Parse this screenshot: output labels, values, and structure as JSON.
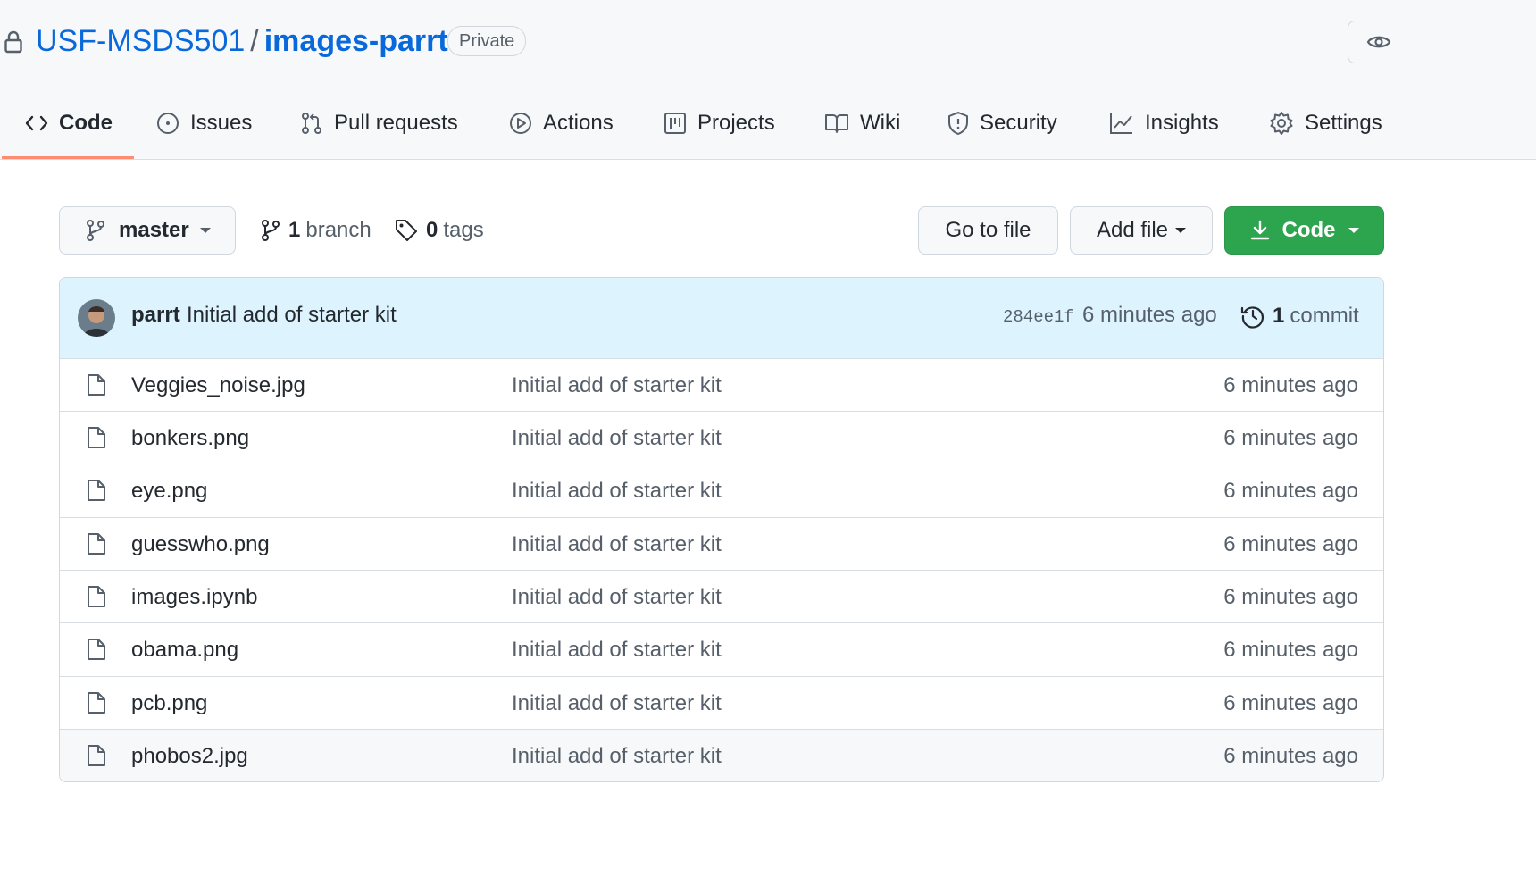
{
  "repo": {
    "owner": "USF-MSDS501",
    "separator": "/",
    "name": "images-parrt",
    "visibility": "Private"
  },
  "tabs": [
    {
      "label": "Code",
      "icon": "code-icon",
      "selected": true
    },
    {
      "label": "Issues",
      "icon": "issue-icon"
    },
    {
      "label": "Pull requests",
      "icon": "pull-request-icon"
    },
    {
      "label": "Actions",
      "icon": "play-icon"
    },
    {
      "label": "Projects",
      "icon": "project-icon"
    },
    {
      "label": "Wiki",
      "icon": "book-icon"
    },
    {
      "label": "Security",
      "icon": "shield-icon"
    },
    {
      "label": "Insights",
      "icon": "graph-icon"
    },
    {
      "label": "Settings",
      "icon": "gear-icon"
    }
  ],
  "branch": {
    "current": "master",
    "branch_count": "1",
    "branch_label": "branch",
    "tag_count": "0",
    "tag_label": "tags"
  },
  "actions": {
    "go_to_file": "Go to file",
    "add_file": "Add file",
    "code": "Code"
  },
  "latest_commit": {
    "author": "parrt",
    "message": "Initial add of starter kit",
    "sha": "284ee1f",
    "time": "6 minutes ago",
    "commit_count": "1",
    "commit_label": "commit"
  },
  "files": [
    {
      "name": "Veggies_noise.jpg",
      "message": "Initial add of starter kit",
      "time": "6 minutes ago"
    },
    {
      "name": "bonkers.png",
      "message": "Initial add of starter kit",
      "time": "6 minutes ago"
    },
    {
      "name": "eye.png",
      "message": "Initial add of starter kit",
      "time": "6 minutes ago"
    },
    {
      "name": "guesswho.png",
      "message": "Initial add of starter kit",
      "time": "6 minutes ago"
    },
    {
      "name": "images.ipynb",
      "message": "Initial add of starter kit",
      "time": "6 minutes ago"
    },
    {
      "name": "obama.png",
      "message": "Initial add of starter kit",
      "time": "6 minutes ago"
    },
    {
      "name": "pcb.png",
      "message": "Initial add of starter kit",
      "time": "6 minutes ago"
    },
    {
      "name": "phobos2.jpg",
      "message": "Initial add of starter kit",
      "time": "6 minutes ago"
    }
  ],
  "colors": {
    "link": "#0969da",
    "primary_button": "#2da44e",
    "tab_underline": "#fd8c73",
    "commit_bar": "#ddf4ff"
  }
}
